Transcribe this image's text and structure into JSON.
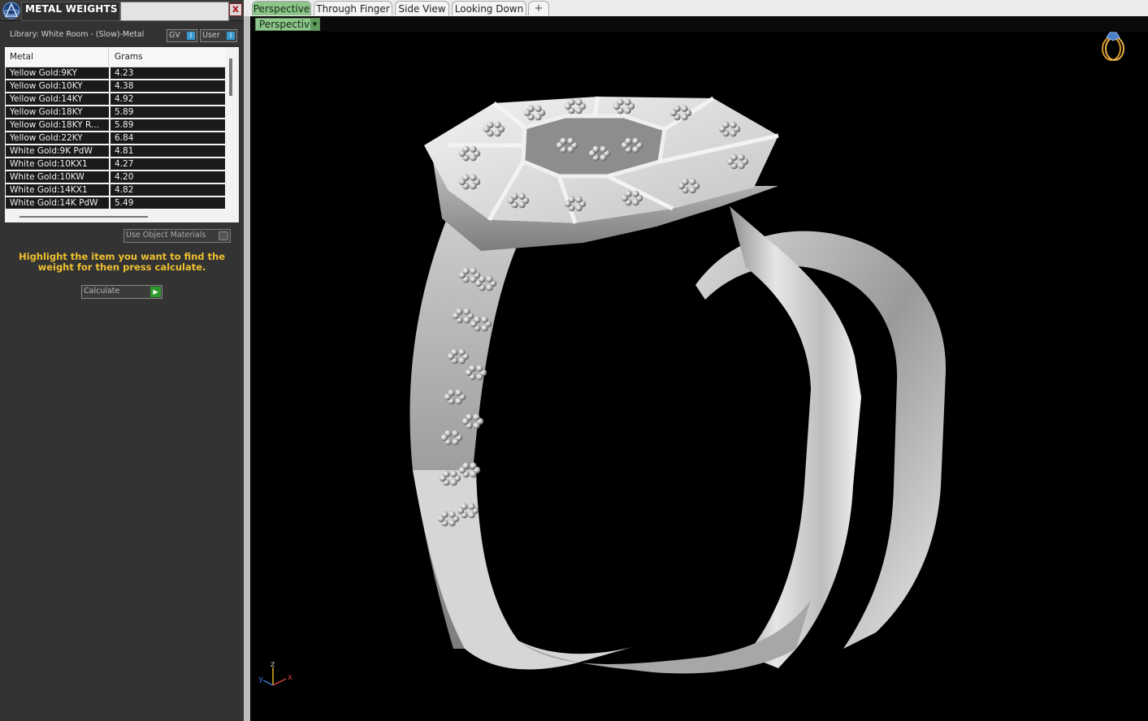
{
  "panel": {
    "title": "METAL WEIGHTS",
    "close_label": "x",
    "library_label": "Library: White Room - (Slow)-Metal",
    "gv_label": "GV",
    "user_label": "User",
    "toggle_knob": "I",
    "table": {
      "columns": [
        "Metal",
        "Grams"
      ],
      "rows": [
        {
          "metal": "Yellow Gold:9KY",
          "grams": "4.23"
        },
        {
          "metal": "Yellow Gold:10KY",
          "grams": "4.38"
        },
        {
          "metal": "Yellow Gold:14KY",
          "grams": "4.92"
        },
        {
          "metal": "Yellow Gold:18KY",
          "grams": "5.89"
        },
        {
          "metal": "Yellow Gold:18KY R...",
          "grams": "5.89"
        },
        {
          "metal": "Yellow Gold:22KY",
          "grams": "6.84"
        },
        {
          "metal": "White Gold:9K PdW",
          "grams": "4.81"
        },
        {
          "metal": "White Gold:10KX1",
          "grams": "4.27"
        },
        {
          "metal": "White Gold:10KW",
          "grams": "4.20"
        },
        {
          "metal": "White Gold:14KX1",
          "grams": "4.82"
        },
        {
          "metal": "White Gold:14K PdW",
          "grams": "5.49"
        }
      ]
    },
    "use_object_materials": "Use Object Materials",
    "hint": "Highlight the item you want to find the weight for then press calculate.",
    "calculate_label": "Calculate"
  },
  "tabs": [
    {
      "label": "Perspective",
      "active": true
    },
    {
      "label": "Through Finger",
      "active": false
    },
    {
      "label": "Side View",
      "active": false
    },
    {
      "label": "Looking Down",
      "active": false
    }
  ],
  "add_tab_label": "+",
  "view_dropdown": {
    "selected": "Perspective"
  },
  "axes": {
    "z": "z",
    "x": "x",
    "y": "y"
  },
  "colors": {
    "active_tab": "#8dc58a",
    "hint_text": "#f0c030",
    "viewport_bg": "#000000",
    "toggle_knob": "#3a9ad0",
    "calculate_play": "#2e9a2e",
    "close_x": "#b01818"
  }
}
